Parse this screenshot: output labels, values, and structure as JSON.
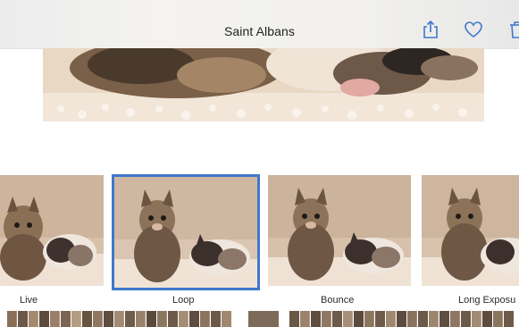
{
  "nav": {
    "title": "Saint Albans",
    "share_icon": "share-icon",
    "favorite_icon": "heart-icon",
    "delete_icon": "trash-icon",
    "tint_color": "#3f78c9"
  },
  "effects": {
    "selected": "Loop",
    "items": [
      {
        "label": "Live"
      },
      {
        "label": "Loop"
      },
      {
        "label": "Bounce"
      },
      {
        "label": "Long Exposu"
      }
    ]
  }
}
